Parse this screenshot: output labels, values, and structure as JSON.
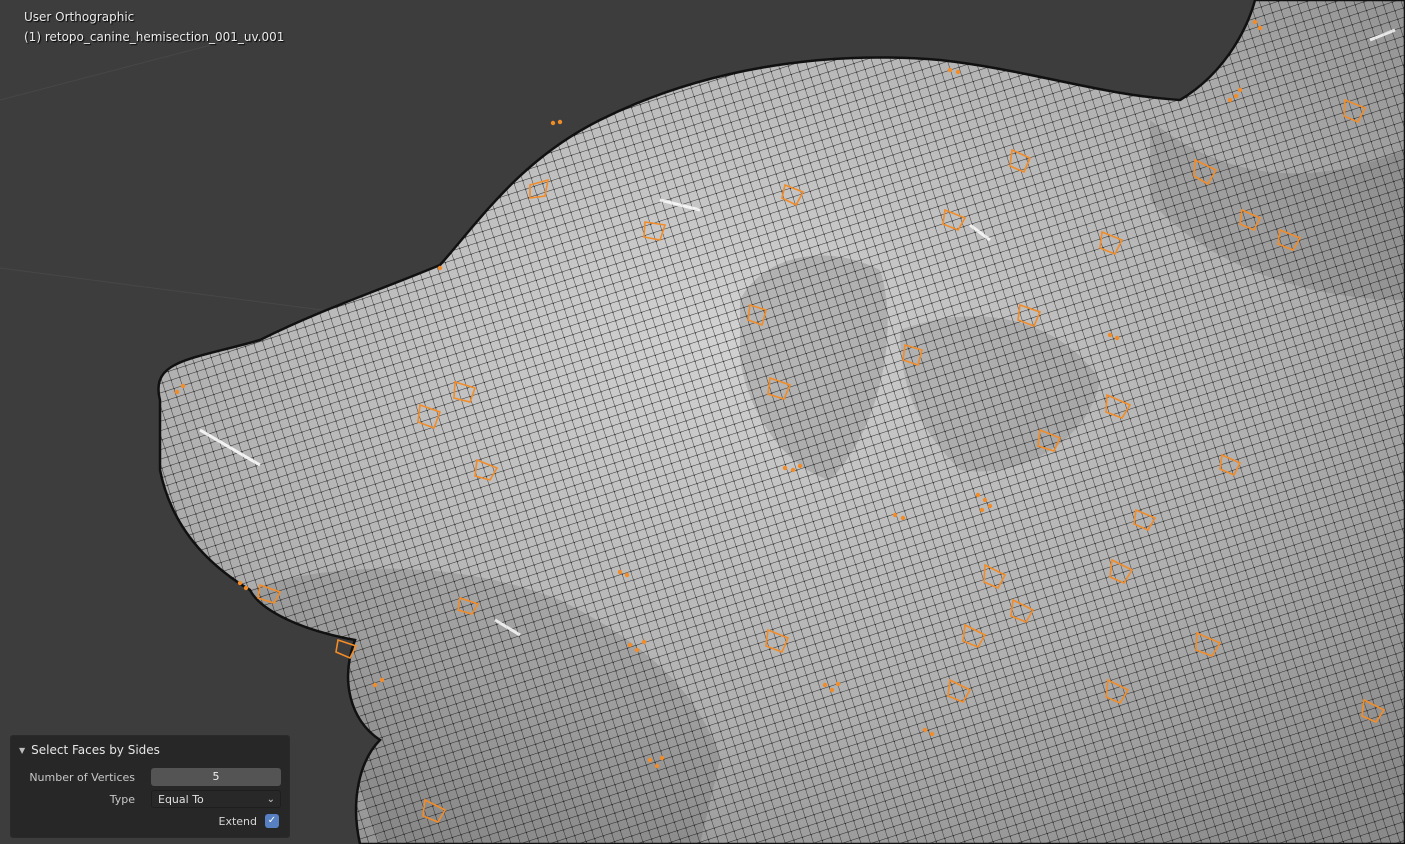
{
  "viewport": {
    "view_name": "User Orthographic",
    "object_name": "(1) retopo_canine_hemisection_001_uv.001",
    "background_color": "#3d3d3d",
    "mesh_color": "#b9b9b9",
    "wire_color": "#111111",
    "selected_color": "#f28c28"
  },
  "operator_panel": {
    "title": "Select Faces by Sides",
    "collapse_icon": "triangle-down-icon",
    "fields": {
      "number_of_vertices": {
        "label": "Number of Vertices",
        "value": "5"
      },
      "type": {
        "label": "Type",
        "value": "Equal To"
      },
      "extend": {
        "label": "Extend",
        "checked": true
      }
    },
    "accent_color": "#5680c2"
  }
}
